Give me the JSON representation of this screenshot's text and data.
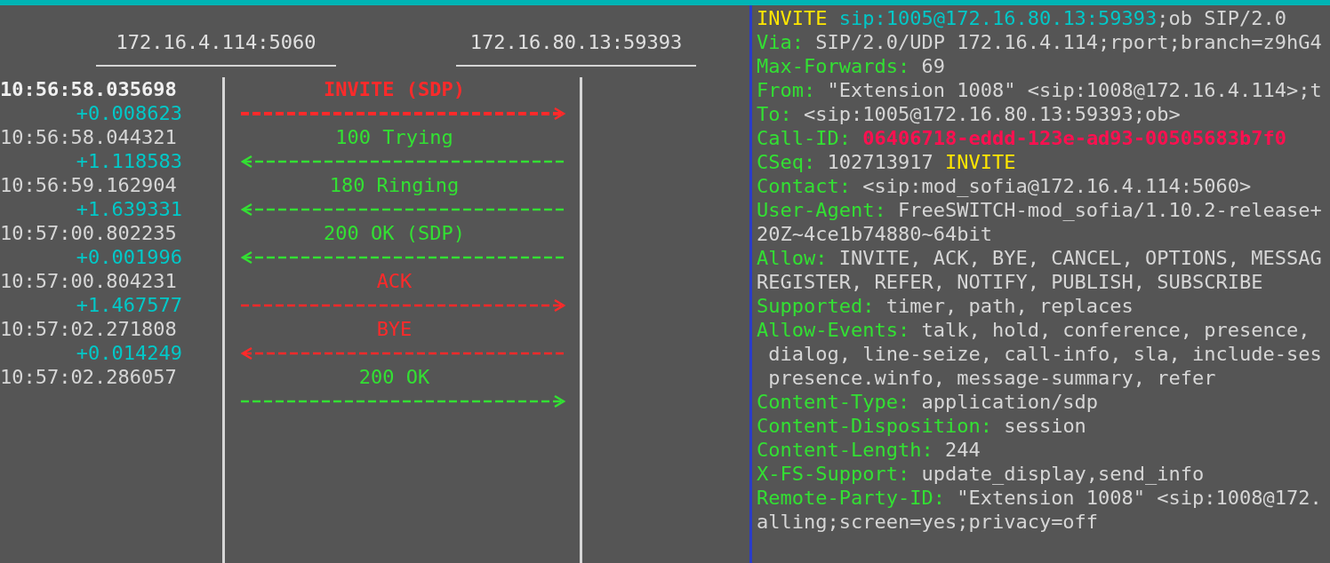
{
  "flow": {
    "hosts": [
      "172.16.4.114:5060",
      "172.16.80.13:59393"
    ],
    "messages": [
      {
        "time": "10:56:58.035698",
        "delta": "+0.008623",
        "label": "INVITE (SDP)",
        "kind": "rightward",
        "color": "#ff2a2a",
        "selected": true
      },
      {
        "time": "10:56:58.044321",
        "delta": "+1.118583",
        "label": "100 Trying",
        "kind": "leftward",
        "color": "#33e033",
        "selected": false
      },
      {
        "time": "10:56:59.162904",
        "delta": "+1.639331",
        "label": "180 Ringing",
        "kind": "leftward",
        "color": "#33e033",
        "selected": false
      },
      {
        "time": "10:57:00.802235",
        "delta": "+0.001996",
        "label": "200 OK (SDP)",
        "kind": "leftward",
        "color": "#33e033",
        "selected": false
      },
      {
        "time": "10:57:00.804231",
        "delta": "+1.467577",
        "label": "ACK",
        "kind": "rightward",
        "color": "#ff2a2a",
        "selected": false
      },
      {
        "time": "10:57:02.271808",
        "delta": "+0.014249",
        "label": "BYE",
        "kind": "leftward",
        "color": "#ff2a2a",
        "selected": false
      },
      {
        "time": "10:57:02.286057",
        "label": "200 OK",
        "kind": "rightward",
        "color": "#33e033",
        "selected": false
      }
    ]
  },
  "message_detail": {
    "lines": [
      {
        "segments": [
          {
            "kind": "method",
            "text": "INVITE "
          },
          {
            "kind": "uri",
            "text": "sip:1005@172.16.80.13:59393"
          },
          {
            "kind": "text",
            "text": ";ob SIP/2.0"
          }
        ]
      },
      {
        "segments": [
          {
            "kind": "header",
            "text": "Via:"
          },
          {
            "kind": "text",
            "text": " SIP/2.0/UDP 172.16.4.114;rport;branch=z9hG4"
          }
        ]
      },
      {
        "segments": [
          {
            "kind": "header",
            "text": "Max-Forwards:"
          },
          {
            "kind": "text",
            "text": " 69"
          }
        ]
      },
      {
        "segments": [
          {
            "kind": "header",
            "text": "From:"
          },
          {
            "kind": "text",
            "text": " \"Extension 1008\" <sip:1008@172.16.4.114>;t"
          }
        ]
      },
      {
        "segments": [
          {
            "kind": "header",
            "text": "To:"
          },
          {
            "kind": "text",
            "text": " <sip:1005@172.16.80.13:59393;ob>"
          }
        ]
      },
      {
        "segments": [
          {
            "kind": "header",
            "text": "Call-ID: "
          },
          {
            "kind": "callid",
            "text": "06406718-eddd-123e-ad93-00505683b7f0"
          }
        ]
      },
      {
        "segments": [
          {
            "kind": "header",
            "text": "CSeq:"
          },
          {
            "kind": "text",
            "text": " 102713917 "
          },
          {
            "kind": "method",
            "text": "INVITE"
          }
        ]
      },
      {
        "segments": [
          {
            "kind": "header",
            "text": "Contact:"
          },
          {
            "kind": "text",
            "text": " <sip:mod_sofia@172.16.4.114:5060>"
          }
        ]
      },
      {
        "segments": [
          {
            "kind": "header",
            "text": "User-Agent:"
          },
          {
            "kind": "text",
            "text": " FreeSWITCH-mod_sofia/1.10.2-release+"
          }
        ]
      },
      {
        "segments": [
          {
            "kind": "text",
            "text": "20Z~4ce1b74880~64bit"
          }
        ]
      },
      {
        "segments": [
          {
            "kind": "header",
            "text": "Allow:"
          },
          {
            "kind": "text",
            "text": " INVITE, ACK, BYE, CANCEL, OPTIONS, MESSAG"
          }
        ]
      },
      {
        "segments": [
          {
            "kind": "text",
            "text": "REGISTER, REFER, NOTIFY, PUBLISH, SUBSCRIBE"
          }
        ]
      },
      {
        "segments": [
          {
            "kind": "header",
            "text": "Supported:"
          },
          {
            "kind": "text",
            "text": " timer, path, replaces"
          }
        ]
      },
      {
        "segments": [
          {
            "kind": "header",
            "text": "Allow-Events:"
          },
          {
            "kind": "text",
            "text": " talk, hold, conference, presence,"
          }
        ]
      },
      {
        "segments": [
          {
            "kind": "text",
            "text": " dialog, line-seize, call-info, sla, include-ses"
          }
        ]
      },
      {
        "segments": [
          {
            "kind": "text",
            "text": " presence.winfo, message-summary, refer"
          }
        ]
      },
      {
        "segments": [
          {
            "kind": "header",
            "text": "Content-Type:"
          },
          {
            "kind": "text",
            "text": " application/sdp"
          }
        ]
      },
      {
        "segments": [
          {
            "kind": "header",
            "text": "Content-Disposition:"
          },
          {
            "kind": "text",
            "text": " session"
          }
        ]
      },
      {
        "segments": [
          {
            "kind": "header",
            "text": "Content-Length:"
          },
          {
            "kind": "text",
            "text": " 244"
          }
        ]
      },
      {
        "segments": [
          {
            "kind": "header",
            "text": "X-FS-Support:"
          },
          {
            "kind": "text",
            "text": " update_display,send_info"
          }
        ]
      },
      {
        "segments": [
          {
            "kind": "header",
            "text": "Remote-Party-ID:"
          },
          {
            "kind": "text",
            "text": " \"Extension 1008\" <sip:1008@172."
          }
        ]
      },
      {
        "segments": [
          {
            "kind": "text",
            "text": "alling;screen=yes;privacy=off"
          }
        ]
      }
    ]
  }
}
